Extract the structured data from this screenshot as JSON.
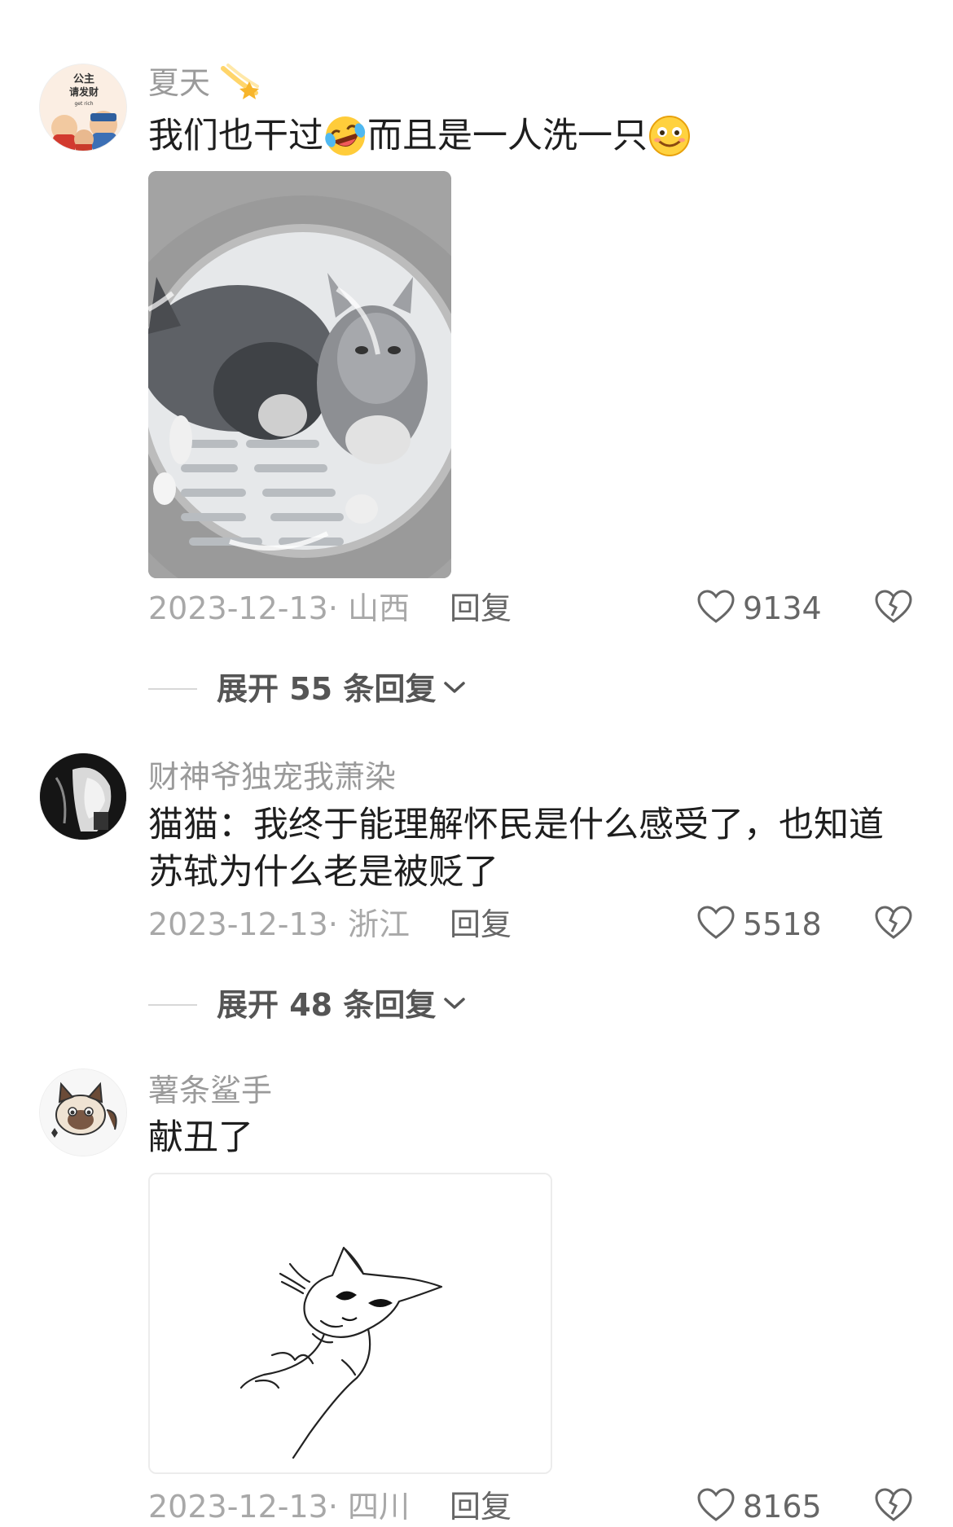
{
  "comments": [
    {
      "author": "夏天",
      "author_badge_icon": "comet-icon",
      "text_parts": [
        "我们也干过",
        "而且是一人洗一只"
      ],
      "inline_emojis": [
        "laugh-cry-emoji",
        "smile-emoji"
      ],
      "date": "2023-12-13",
      "location": "· 山西",
      "reply_label": "回复",
      "likes": "9134",
      "expand_label": "展开 55 条回复",
      "avatar_text_1": "公主",
      "avatar_text_2": "请发财",
      "avatar_text_3": "get rich"
    },
    {
      "author": "财神爷独宠我萧染",
      "text": "猫猫：我终于能理解怀民是什么感受了，也知道苏轼为什么老是被贬了",
      "date": "2023-12-13",
      "location": "· 浙江",
      "reply_label": "回复",
      "likes": "5518",
      "expand_label": "展开 48 条回复"
    },
    {
      "author": "薯条鲨手",
      "text": "献丑了",
      "date": "2023-12-13",
      "location": "· 四川",
      "reply_label": "回复",
      "likes": "8165"
    }
  ],
  "colors": {
    "author": "#9a9a9a",
    "meta": "#a8a8a8",
    "text": "#1e1e1e"
  }
}
